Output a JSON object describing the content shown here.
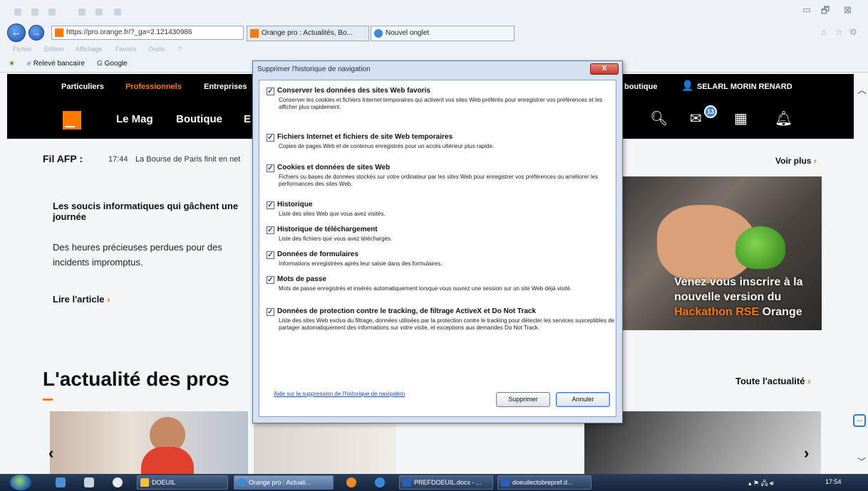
{
  "browser": {
    "address": "https://pro.orange.fr/?_ga=2.121430986",
    "tabs": [
      {
        "label": "Orange pro : Actualités, Bo..."
      },
      {
        "label": "Nouvel onglet"
      }
    ],
    "menu": [
      "Fichier",
      "Edition",
      "Affichage",
      "Favoris",
      "Outils",
      "?"
    ],
    "favorites": [
      "Relevé bancaire",
      "Google"
    ],
    "window_controls": {
      "minimize": "▭",
      "maximize": "🗗",
      "close": "⊠"
    }
  },
  "page": {
    "top_nav": [
      "Particuliers",
      "Professionnels",
      "Entreprises",
      "boutique",
      "SELARL MORIN RENARD"
    ],
    "main_nav": [
      "Le Mag",
      "Boutique",
      "E"
    ],
    "mail_count": "13",
    "afp": {
      "label": "Fil AFP :",
      "time": "17:44",
      "text": "La Bourse de Paris finit en net"
    },
    "voir_plus": "Voir plus",
    "article": {
      "title": "Les soucis informatiques qui gâchent une journée",
      "body": "Des heures précieuses perdues pour des incidents impromptus.",
      "link": "Lire l'article"
    },
    "hero": {
      "line1": "Venez vous inscrire à la",
      "line2": "nouvelle version du",
      "hack": "Hackathon RSE",
      "brand": "Orange"
    },
    "section_title": "L'actualité des pros",
    "toute": "Toute l'actualité"
  },
  "dialog": {
    "title": "Supprimer l'historique de navigation",
    "close": "X",
    "options": [
      {
        "title": "Conserver les données des sites Web favoris",
        "desc": "Conserver les cookies et fichiers Internet temporaires qui activent vos sites Web préférés pour enregistrer vos préférences et les afficher plus rapidement.",
        "checked": true
      },
      {
        "title": "Fichiers Internet et fichiers de site Web temporaires",
        "desc": "Copies de pages Web et de contenus enregistrés pour un accès ultérieur plus rapide.",
        "checked": true
      },
      {
        "title": "Cookies et données de sites Web",
        "desc": "Fichiers ou bases de données stockés sur votre ordinateur par les sites Web pour enregistrer vos préférences ou améliorer les performances des sites Web.",
        "checked": true
      },
      {
        "title": "Historique",
        "desc": "Liste des sites Web que vous avez visités.",
        "checked": true
      },
      {
        "title": "Historique de téléchargement",
        "desc": "Liste des fichiers que vous avez téléchargés.",
        "checked": true
      },
      {
        "title": "Données de formulaires",
        "desc": "Informations enregistrées après leur saisie dans des formulaires.",
        "checked": true
      },
      {
        "title": "Mots de passe",
        "desc": "Mots de passe enregistrés et insérés automatiquement lorsque vous ouvrez une session sur un site Web déjà visité.",
        "checked": true
      },
      {
        "title": "Données de protection contre le tracking, de filtrage ActiveX et Do Not Track",
        "desc": "Liste des sites Web exclus du filtrage, données utilisées par la protection contre le tracking pour détecter les services susceptibles de partager automatiquement des informations sur votre visite, et exceptions aux demandes Do Not Track.",
        "checked": true
      }
    ],
    "help_link": "Aide sur la suppression de l'historique de navigation",
    "btn_delete": "Supprimer",
    "btn_cancel": "Annuler"
  },
  "taskbar": {
    "tasks": [
      "DOEUIL",
      "Orange pro : Actuali...",
      "PREFDOEUIL.docx - ...",
      "doeuilectobrepref.d..."
    ],
    "clock": "17:54"
  },
  "colors": {
    "orange": "#ff7900",
    "dialog_bg": "#d5e1f0",
    "taskbar": "#1c2f4b"
  }
}
